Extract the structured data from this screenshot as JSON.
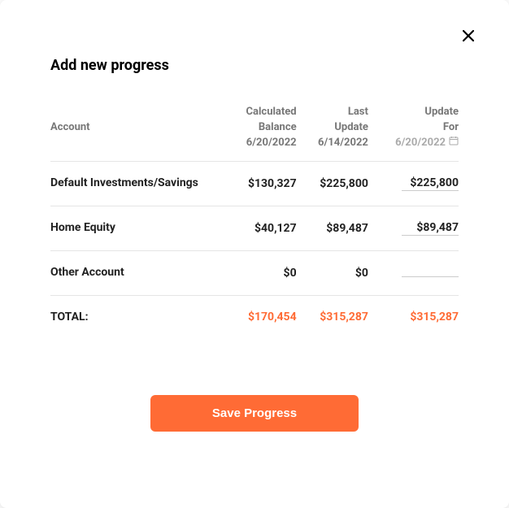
{
  "dialog": {
    "title": "Add new progress"
  },
  "headers": {
    "account": "Account",
    "calculated_l1": "Calculated",
    "calculated_l2": "Balance",
    "calculated_date": "6/20/2022",
    "last_l1": "Last",
    "last_l2": "Update",
    "last_date": "6/14/2022",
    "update_l1": "Update",
    "update_l2": "For",
    "update_date": "6/20/2022"
  },
  "rows": [
    {
      "account": "Default Investments/Savings",
      "calculated": "$130,327",
      "last": "$225,800",
      "update": "$225,800"
    },
    {
      "account": "Home Equity",
      "calculated": "$40,127",
      "last": "$89,487",
      "update": "$89,487"
    },
    {
      "account": "Other Account",
      "calculated": "$0",
      "last": "$0",
      "update": ""
    }
  ],
  "total": {
    "label": "TOTAL:",
    "calculated": "$170,454",
    "last": "$315,287",
    "update": "$315,287"
  },
  "buttons": {
    "save": "Save Progress"
  }
}
